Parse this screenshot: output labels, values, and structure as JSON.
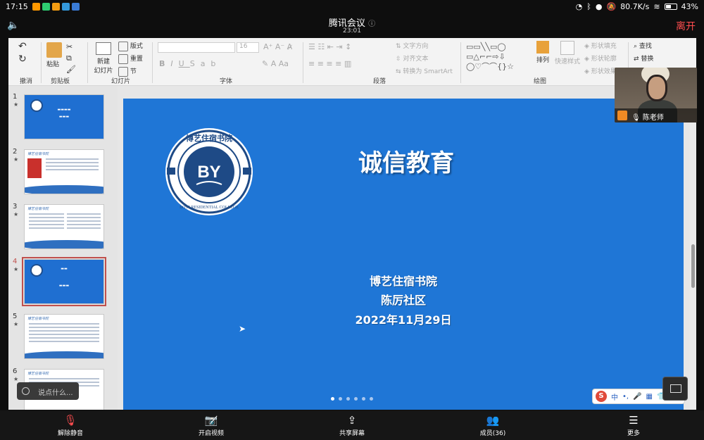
{
  "statusbar": {
    "time": "17:15",
    "net_speed": "80.7K/s",
    "battery": "43%",
    "app_colors": [
      "#ffb300",
      "#2ecc71",
      "#f39c12",
      "#3498db",
      "#3a7bd5"
    ]
  },
  "meeting": {
    "title": "腾讯会议",
    "info_icon": "ⓘ",
    "timer": "23:01",
    "leave": "离开"
  },
  "ribbon": {
    "groups": [
      "撤消",
      "剪贴板",
      "幻灯片",
      "字体",
      "段落",
      "绘图"
    ],
    "paste": "粘贴",
    "new_slide": "新建\n幻灯片",
    "layout": "版式",
    "reset": "重置",
    "section": "节",
    "font_size": "16",
    "text_direction": "文字方向",
    "align_text": "对齐文本",
    "smartart": "转换为 SmartArt",
    "arrange": "排列",
    "quick_styles": "快速样式",
    "shape_fill": "形状填充",
    "shape_outline": "形状轮廓",
    "shape_effects": "形状效果",
    "find": "查找",
    "replace": "替换",
    "font_buttons": [
      "B",
      "I",
      "U",
      "S",
      "ab"
    ]
  },
  "thumbnails": [
    {
      "num": "1",
      "type": "title"
    },
    {
      "num": "2",
      "type": "content"
    },
    {
      "num": "3",
      "type": "content"
    },
    {
      "num": "4",
      "type": "title",
      "selected": true
    },
    {
      "num": "5",
      "type": "content"
    },
    {
      "num": "6",
      "type": "content"
    }
  ],
  "slide": {
    "title": "诚信教育",
    "line1": "博艺住宿书院",
    "line2": "陈厉社区",
    "line3": "2022年11月29日",
    "logo_text": "BY",
    "logo_ring": "BOYI RESIDENTIAL COLLEGE",
    "logo_top": "博艺住宿书院"
  },
  "ime": {
    "logo": "S",
    "mode": "中"
  },
  "video": {
    "name": "陈老师"
  },
  "chat": {
    "placeholder": "说点什么..."
  },
  "toolbar": {
    "items": [
      {
        "label": "解除静音",
        "icon": "mic-muted-icon"
      },
      {
        "label": "开启视频",
        "icon": "camera-off-icon"
      },
      {
        "label": "共享屏幕",
        "icon": "share-screen-icon"
      },
      {
        "label": "成员(36)",
        "icon": "members-icon"
      },
      {
        "label": "更多",
        "icon": "more-icon"
      }
    ]
  }
}
